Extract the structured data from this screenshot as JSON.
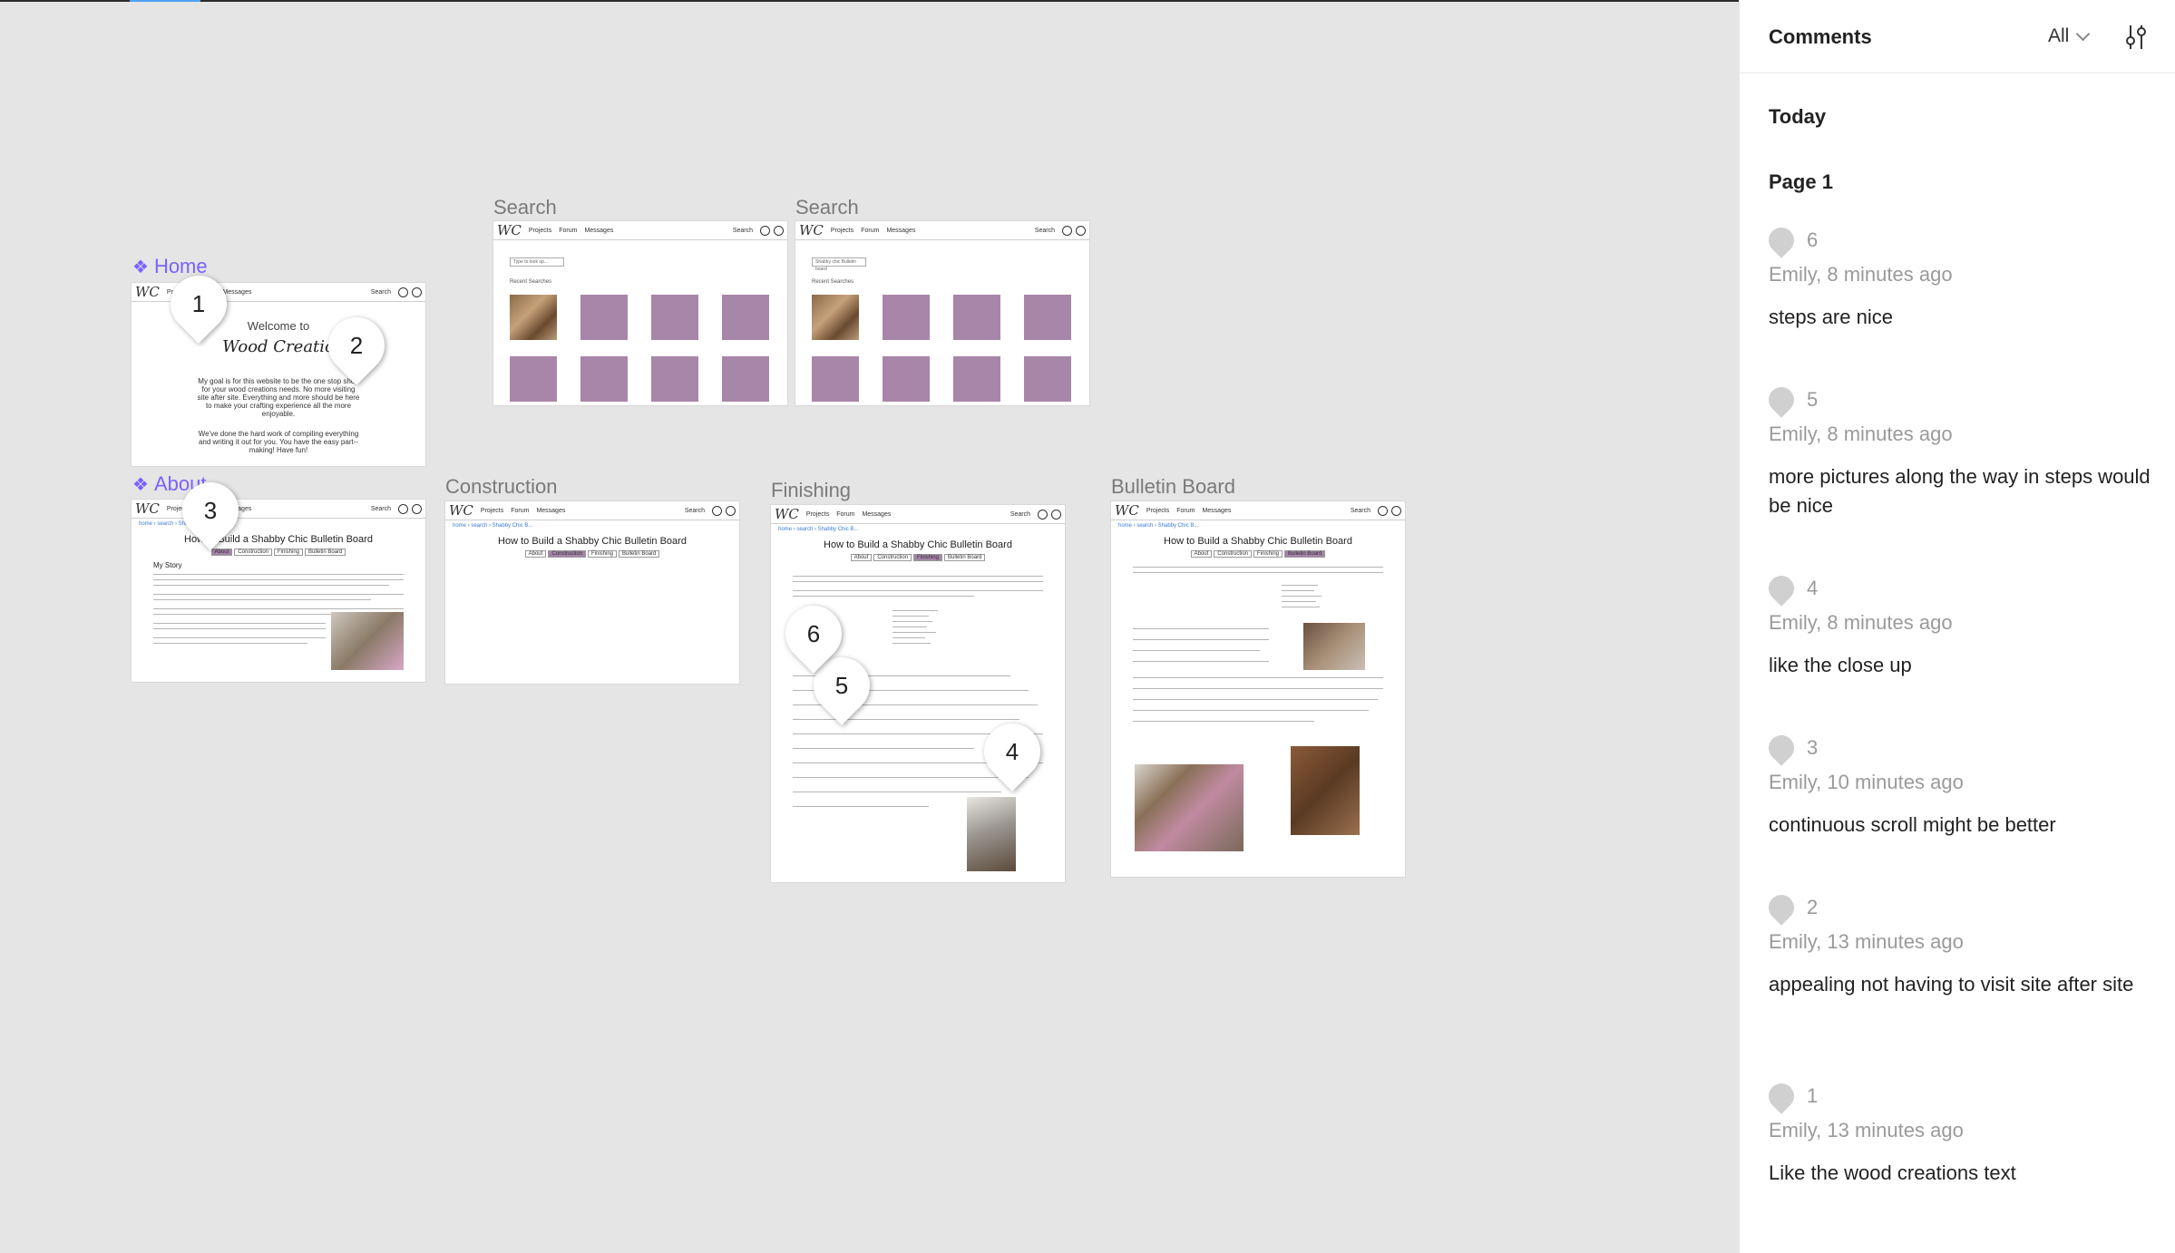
{
  "canvas": {
    "frames": {
      "home": {
        "label": "Home",
        "welcome": "Welcome to",
        "brand": "Wood Creatio",
        "para1": "My goal is for this website to be the one stop shop for your wood creations needs. No more visiting site after site. Everything and more should be here to make your crafting experience all the more enjoyable.",
        "para2": "We've done the hard work of compiling everything and writing it out for you. You have the easy part--making! Have fun!"
      },
      "search1": {
        "label": "Search",
        "box": "Type to look up...",
        "section": "Recent Searches"
      },
      "search2": {
        "label": "Search",
        "box": "Shabby chic Bulletin board",
        "section": "Recent Searches"
      },
      "about": {
        "label": "About",
        "story_heading": "My Story"
      },
      "construction": {
        "label": "Construction"
      },
      "finishing": {
        "label": "Finishing"
      },
      "bulletin": {
        "label": "Bulletin Board"
      }
    },
    "nav": {
      "logo": "WC",
      "projects": "Projects",
      "forum": "Forum",
      "messages": "Messages",
      "search": "Search"
    },
    "crumbs": "home › search › Shabby Chic B...",
    "project_title": "How to Build a Shabby Chic Bulletin Board",
    "tabs": [
      "About",
      "Construction",
      "Finishing",
      "Bulletin Board"
    ],
    "pins": [
      "1",
      "2",
      "3",
      "4",
      "5",
      "6"
    ]
  },
  "sidebar": {
    "title": "Comments",
    "filter": "All",
    "settings_icon": "sliders-icon",
    "day": "Today",
    "page": "Page 1",
    "comments": [
      {
        "num": "6",
        "meta": "Emily, 8 minutes ago",
        "text": "steps are nice"
      },
      {
        "num": "5",
        "meta": "Emily, 8 minutes ago",
        "text": "more pictures along the way in steps would be nice"
      },
      {
        "num": "4",
        "meta": "Emily, 8 minutes ago",
        "text": "like the close up"
      },
      {
        "num": "3",
        "meta": "Emily, 10 minutes ago",
        "text": "continuous scroll might be better"
      },
      {
        "num": "2",
        "meta": "Emily, 13 minutes ago",
        "text": "appealing not having to visit site after site"
      },
      {
        "num": "1",
        "meta": "Emily, 13 minutes ago",
        "text": "Like the wood creations text"
      }
    ]
  },
  "colors": {
    "placeholder": "#a886a9",
    "component": "#7b61ff",
    "accent": "#4fa3f7"
  }
}
